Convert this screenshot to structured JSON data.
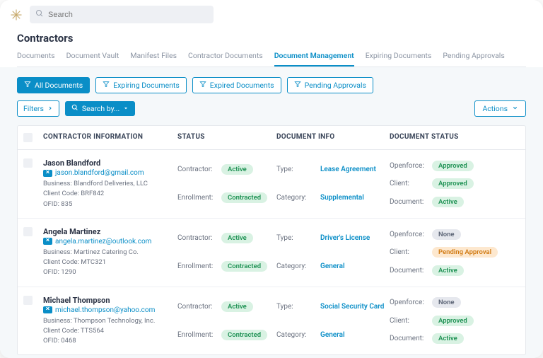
{
  "search": {
    "placeholder": "Search"
  },
  "page_title": "Contractors",
  "tabs": [
    "Documents",
    "Document Vault",
    "Manifest Files",
    "Contractor Documents",
    "Document Management",
    "Expiring Documents",
    "Pending Approvals"
  ],
  "active_tab": "Document Management",
  "doc_filters": [
    "All Documents",
    "Expiring Documents",
    "Expired Documents",
    "Pending Approvals"
  ],
  "filters_label": "Filters",
  "searchby_label": "Search by...",
  "actions_label": "Actions",
  "columns": [
    "CONTRACTOR INFORMATION",
    "STATUS",
    "DOCUMENT INFO",
    "DOCUMENT STATUS"
  ],
  "status_labels": {
    "contractor": "Contractor:",
    "enrollment": "Enrollment:"
  },
  "docinfo_labels": {
    "type": "Type:",
    "category": "Category:"
  },
  "docstatus_labels": {
    "openforce": "Openforce:",
    "client": "Client:",
    "document": "Document:"
  },
  "rows": [
    {
      "name": "Jason Blandford",
      "email": "jason.blandford@gmail.com",
      "business": "Business: Blandford Deliveries, LLC",
      "client_code": "Client Code: BRF842",
      "ofid": "OFID: 835",
      "contractor_status": "Active",
      "enrollment_status": "Contracted",
      "doc_type": "Lease Agreement",
      "doc_category": "Supplemental",
      "openforce": {
        "text": "Approved",
        "class": "green"
      },
      "client": {
        "text": "Approved",
        "class": "green"
      },
      "document": {
        "text": "Active",
        "class": "green"
      }
    },
    {
      "name": "Angela Martinez",
      "email": "angela.martinez@outlook.com",
      "business": "Business: Martinez Catering Co.",
      "client_code": "Client Code: MTC321",
      "ofid": "OFID: 1290",
      "contractor_status": "Active",
      "enrollment_status": "Contracted",
      "doc_type": "Driver's License",
      "doc_category": "General",
      "openforce": {
        "text": "None",
        "class": "gray"
      },
      "client": {
        "text": "Pending Approval",
        "class": "orange"
      },
      "document": {
        "text": "Active",
        "class": "green"
      }
    },
    {
      "name": "Michael Thompson",
      "email": "michael.thompson@yahoo.com",
      "business": "Business: Thompson Technology, Inc.",
      "client_code": "Client Code: TTS564",
      "ofid": "OFID: 0468",
      "contractor_status": "Active",
      "enrollment_status": "Contracted",
      "doc_type": "Social Security Card",
      "doc_category": "General",
      "openforce": {
        "text": "None",
        "class": "gray"
      },
      "client": {
        "text": "Approved",
        "class": "green"
      },
      "document": {
        "text": "Active",
        "class": "green"
      }
    }
  ]
}
